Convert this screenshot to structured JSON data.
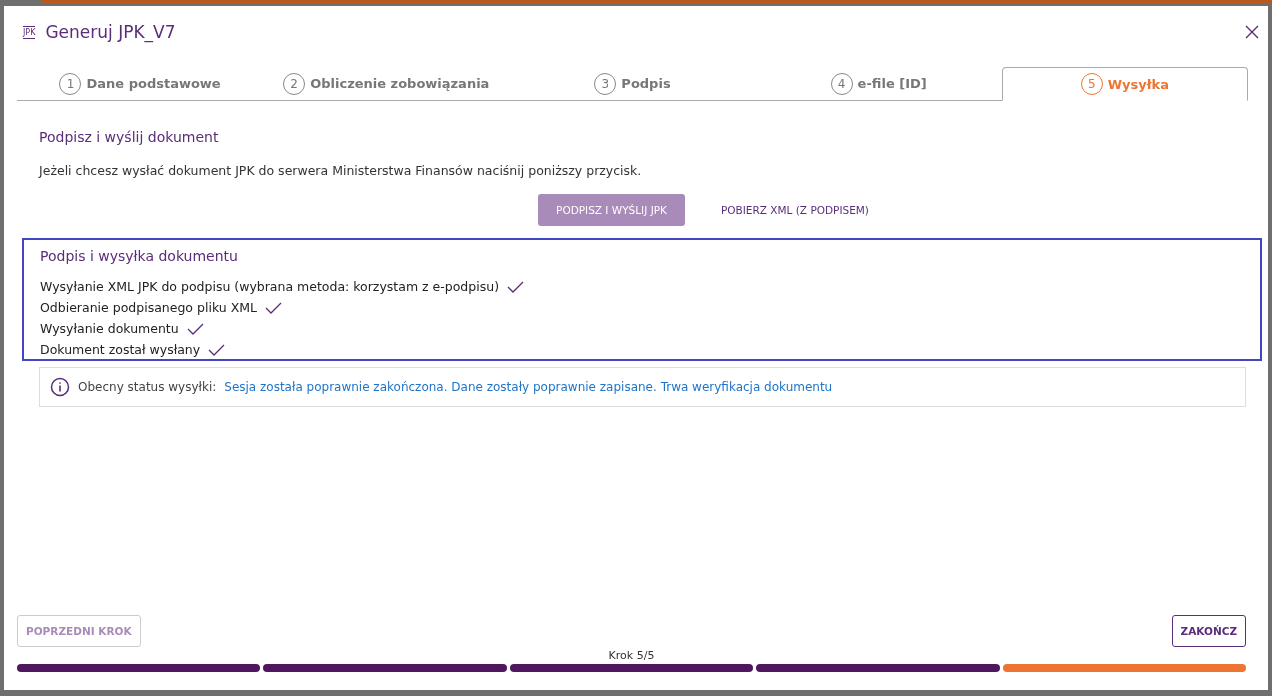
{
  "dialog": {
    "title": "Generuj JPK_V7",
    "logo": "JPK"
  },
  "steps": [
    {
      "number": "1",
      "label": "Dane podstawowe",
      "selected": false
    },
    {
      "number": "2",
      "label": "Obliczenie zobowiązania",
      "selected": false
    },
    {
      "number": "3",
      "label": "Podpis",
      "selected": false
    },
    {
      "number": "4",
      "label": "e-file [ID]",
      "selected": false
    },
    {
      "number": "5",
      "label": "Wysyłka",
      "selected": true
    }
  ],
  "section": {
    "heading": "Podpisz i wyślij dokument",
    "description": "Jeżeli chcesz wysłać dokument JPK do serwera Ministerstwa Finansów naciśnij poniższy przycisk."
  },
  "actions": [
    {
      "kind": "primary",
      "label": "PODPISZ I WYŚLIJ JPK",
      "disabled": true
    },
    {
      "kind": "text",
      "label": "POBIERZ XML (Z PODPISEM)",
      "disabled": false
    }
  ],
  "progress_panel": {
    "heading": "Podpis i wysyłka dokumentu",
    "items": [
      {
        "label": "Wysyłanie XML JPK do podpisu (wybrana metoda: korzystam z e-podpisu)",
        "checked": true
      },
      {
        "label": "Odbieranie podpisanego pliku XML",
        "checked": true
      },
      {
        "label": "Wysyłanie dokumentu",
        "checked": true
      },
      {
        "label": "Dokument został wysłany",
        "checked": true
      }
    ]
  },
  "status": {
    "label": "Obecny status wysyłki:",
    "value": "Sesja została poprawnie zakończona. Dane zostały poprawnie zapisane. Trwa weryfikacja dokumentu"
  },
  "footer": {
    "back_button": {
      "label": "POPRZEDNI KROK",
      "disabled": true
    },
    "finish_button": {
      "label": "ZAKOŃCZ",
      "disabled": false
    },
    "step_label": "Krok 5/5",
    "segments": [
      {
        "selected": false
      },
      {
        "selected": false
      },
      {
        "selected": false
      },
      {
        "selected": false
      },
      {
        "selected": true
      }
    ]
  }
}
